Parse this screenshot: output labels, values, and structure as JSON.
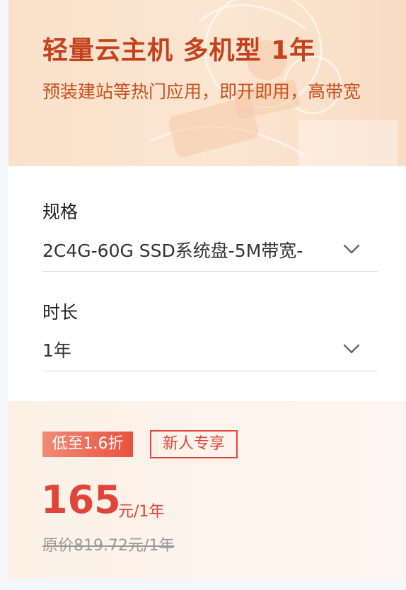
{
  "header": {
    "title": "轻量云主机 多机型 1年",
    "subtitle": "预装建站等热门应用，即开即用，高带宽"
  },
  "form": {
    "spec": {
      "label": "规格",
      "value": "2C4G-60G SSD系统盘-5M带宽-",
      "icon": "chevron-down-icon"
    },
    "duration": {
      "label": "时长",
      "value": "1年",
      "icon": "chevron-down-icon"
    }
  },
  "pricing": {
    "discount_badge": "低至1.6折",
    "new_user_badge": "新人专享",
    "amount": "165",
    "unit": "元/1年",
    "original": "原价819.72元/1年"
  },
  "colors": {
    "accent": "#e0443a",
    "title": "#c4411d",
    "header_bg": "#fbe1cb"
  }
}
